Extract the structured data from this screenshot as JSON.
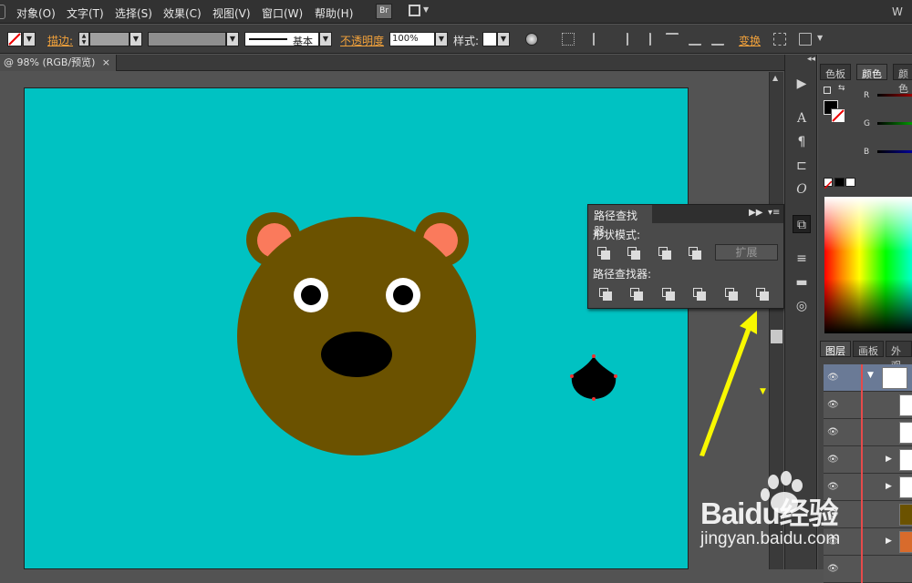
{
  "menu": {
    "items": [
      "对象(O)",
      "文字(T)",
      "选择(S)",
      "效果(C)",
      "视图(V)",
      "窗口(W)",
      "帮助(H)"
    ],
    "bridge_label": "Br",
    "corner_label": "W"
  },
  "control": {
    "stroke_label": "描边:",
    "stroke_profile_label": "基本",
    "opacity_label": "不透明度",
    "opacity_value": "100%",
    "style_label": "样式:",
    "transform_label": "变换"
  },
  "document": {
    "tab_title": "@ 98% (RGB/预览)",
    "close_glyph": "×"
  },
  "pathfinder": {
    "title": "路径查找器",
    "shape_modes_label": "形状模式:",
    "pathfinders_label": "路径查找器:",
    "expand_label": "扩展"
  },
  "color_panel": {
    "tabs": [
      "色板",
      "颜色",
      "颜色"
    ],
    "channels": [
      "R",
      "G",
      "B"
    ]
  },
  "layers_panel": {
    "tabs": [
      "图层",
      "画板",
      "外观"
    ]
  },
  "watermark": {
    "brand": "Baidu经验",
    "url": "jingyan.baidu.com"
  },
  "colors": {
    "artboard": "#00c2c2",
    "bear_body": "#6b5200",
    "bear_ear_inner": "#fa7a5c",
    "arrow": "#f8f800",
    "accent_orange": "#f2a23b"
  }
}
